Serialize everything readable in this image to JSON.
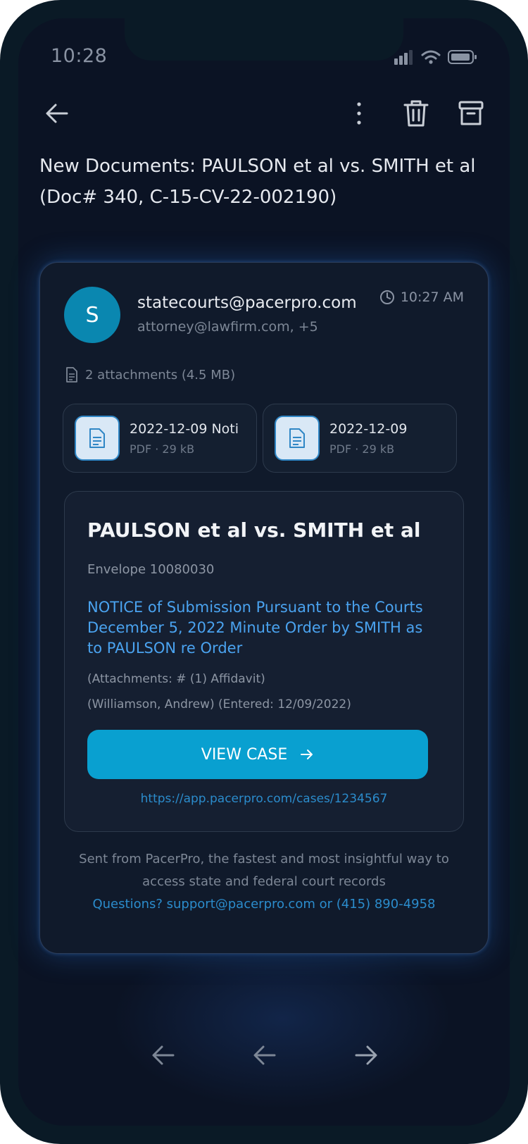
{
  "status_bar": {
    "time": "10:28"
  },
  "email": {
    "subject": "New Documents: PAULSON et al vs. SMITH et al (Doc# 340, C-15-CV-22-002190)",
    "avatar_initial": "S",
    "from": "statecourts@pacerpro.com",
    "to": "attorney@lawfirm.com, +5",
    "time": "10:27 AM",
    "attachments_summary": "2 attachments (4.5 MB)",
    "attachments": [
      {
        "name": "2022-12-09 Noti",
        "meta": "PDF · 29 kB"
      },
      {
        "name": "2022-12-09",
        "meta": "PDF · 29 kB"
      }
    ],
    "case": {
      "title": "PAULSON et al vs. SMITH et al",
      "envelope": "Envelope 10080030",
      "notice": "NOTICE of Submission Pursuant to the Courts December 5, 2022 Minute Order by SMITH as to PAULSON re Order",
      "attachments_line": "(Attachments: # (1) Affidavit)",
      "entered_line": "(Williamson, Andrew) (Entered: 12/09/2022)",
      "button_label": "VIEW CASE",
      "link": "https://app.pacerpro.com/cases/1234567"
    },
    "footer": {
      "line1": "Sent from PacerPro, the fastest and most insightful way to",
      "line2": "access state and federal court records",
      "contact": "Questions? support@pacerpro.com or (415) 890-4958"
    }
  },
  "colors": {
    "accent": "#09a0d0",
    "link": "#4aa3f0",
    "background": "#0b1324"
  }
}
